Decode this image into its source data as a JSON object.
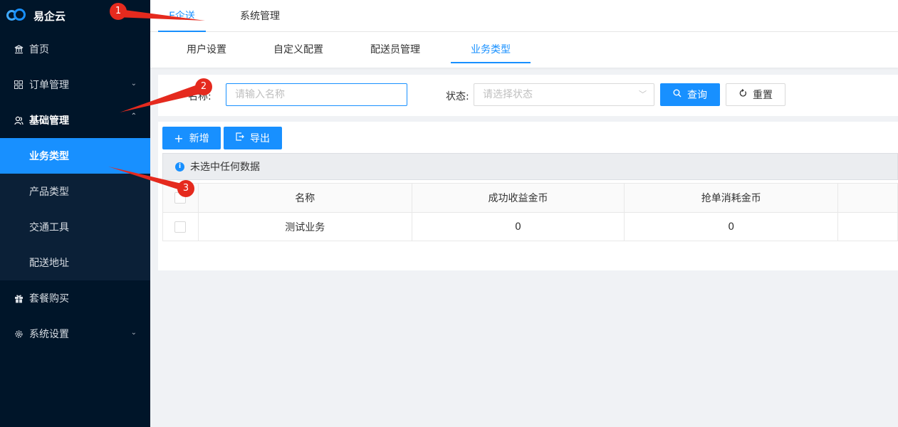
{
  "app": {
    "name": "易企云"
  },
  "sidebar": {
    "items": [
      {
        "label": "首页",
        "icon": "bank-icon"
      },
      {
        "label": "订单管理",
        "icon": "grid-icon"
      },
      {
        "label": "基础管理",
        "icon": "users-icon"
      },
      {
        "label": "套餐购买",
        "icon": "gift-icon"
      },
      {
        "label": "系统设置",
        "icon": "gear-icon"
      }
    ],
    "submenu": [
      {
        "label": "业务类型",
        "active": true
      },
      {
        "label": "产品类型"
      },
      {
        "label": "交通工具"
      },
      {
        "label": "配送地址"
      }
    ]
  },
  "top_tabs": [
    {
      "label": "E企送",
      "active": true
    },
    {
      "label": "系统管理"
    }
  ],
  "sub_tabs": [
    {
      "label": "用户设置"
    },
    {
      "label": "自定义配置"
    },
    {
      "label": "配送员管理"
    },
    {
      "label": "业务类型",
      "active": true
    }
  ],
  "search": {
    "name_label": "名称:",
    "name_placeholder": "请输入名称",
    "status_label": "状态:",
    "status_placeholder": "请选择状态",
    "query_label": "查询",
    "reset_label": "重置"
  },
  "toolbar": {
    "add_label": "新增",
    "export_label": "导出"
  },
  "alert": {
    "text": "未选中任何数据"
  },
  "table": {
    "columns": [
      "名称",
      "成功收益金币",
      "抢单消耗金币"
    ],
    "rows": [
      {
        "name": "测试业务",
        "success_coins": "0",
        "grab_coins": "0"
      }
    ]
  },
  "annotations": [
    "1",
    "2",
    "3"
  ],
  "colors": {
    "sidebar_bg": "#001529",
    "accent": "#1890ff",
    "annotation": "#e52a1e"
  }
}
